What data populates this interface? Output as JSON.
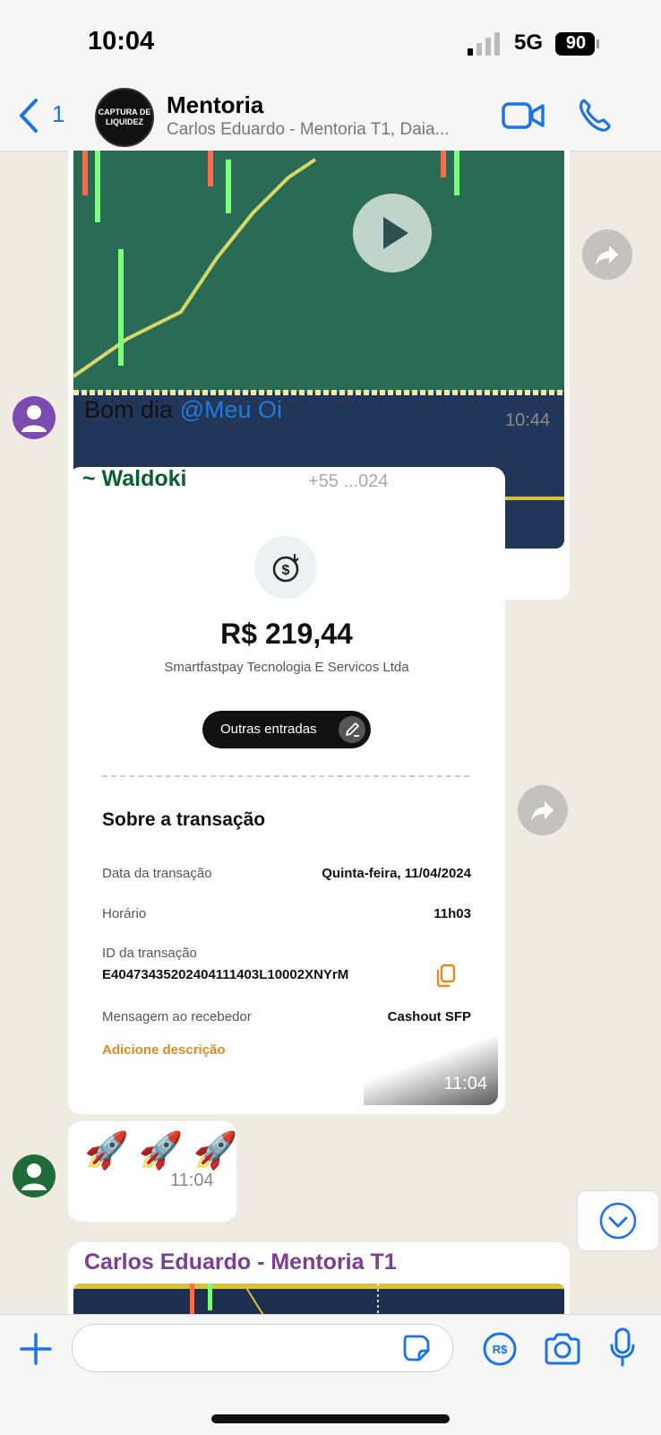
{
  "status": {
    "time": "10:04",
    "network": "5G",
    "battery": "90"
  },
  "header": {
    "back_count": "1",
    "group_avatar_text": "CAPTURA DE LIQUIDEZ",
    "title": "Mentoria",
    "subtitle": "Carlos Eduardo - Mentoria T1, Daia..."
  },
  "messages": {
    "video_msg": {
      "text_prefix": "Bom dia ",
      "mention": "@Meu Oi",
      "time": "10:44"
    },
    "receipt_msg": {
      "sender": "~ Waldoki",
      "sender_phone": "+55 ...024",
      "time": "11:04",
      "receipt": {
        "amount": "R$ 219,44",
        "company": "Smartfastpay Tecnologia E Servicos Ltda",
        "chip": "Outras entradas",
        "section_title": "Sobre a transação",
        "rows": [
          {
            "label": "Data da transação",
            "value": "Quinta-feira, 11/04/2024"
          },
          {
            "label": "Horário",
            "value": "11h03"
          },
          {
            "label": "ID da transação",
            "value": "E40473435202404111403L10002XNYrM"
          },
          {
            "label": "Mensagem ao recebedor",
            "value": "Cashout SFP"
          }
        ],
        "add_description": "Adicione descrição"
      }
    },
    "emoji_msg": {
      "text": "🚀 🚀 🚀",
      "time": "11:04"
    },
    "last_msg": {
      "sender": "Carlos Eduardo - Mentoria T1"
    }
  },
  "colors": {
    "accent": "#1a73e8",
    "chat_bg": "#efeae2",
    "sender_green": "#0b5e2e",
    "sender_purple": "#7a3e93",
    "orange": "#e8891c"
  },
  "icons": [
    "back-chevron-icon",
    "video-call-icon",
    "phone-icon",
    "play-icon",
    "forward-icon",
    "coin-icon",
    "edit-icon",
    "copy-icon",
    "chevron-down-icon",
    "plus-icon",
    "sticker-icon",
    "pix-icon",
    "camera-icon",
    "mic-icon"
  ]
}
